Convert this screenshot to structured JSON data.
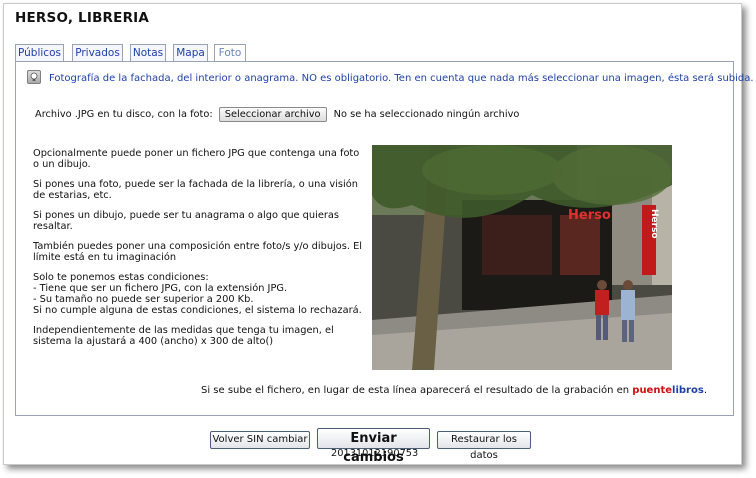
{
  "page": {
    "title": "HERSO, LIBRERIA"
  },
  "tabs": [
    {
      "label": "Públicos",
      "active": false
    },
    {
      "label": "Privados",
      "active": false
    },
    {
      "label": "Notas",
      "active": false
    },
    {
      "label": "Mapa",
      "active": false
    },
    {
      "label": "Foto",
      "active": true
    }
  ],
  "panel": {
    "info_text": "Fotografía de la fachada, del interior o anagrama. NO es obligatorio. Ten en cuenta que nada más seleccionar una imagen, ésta será subida.",
    "file": {
      "label": "Archivo .JPG en tu disco, con la foto:",
      "button_label": "Seleccionar archivo",
      "status": "No se ha seleccionado ningún archivo"
    },
    "description": [
      "Opcionalmente puede poner un fichero JPG que contenga una foto o un dibujo.",
      "Si pones una foto, puede ser la fachada de la librería, o una visión de estarias, etc.",
      "Si pones un dibujo, puede ser tu anagrama o algo que quieras resaltar.",
      "También puedes poner una composición entre foto/s y/o dibujos. El límite está en tu imaginación",
      "Solo te ponemos estas condiciones:\n- Tiene que ser un fichero JPG, con la extensión JPG.\n- Su tamaño no puede ser superior a 200 Kb.\nSi no cumple alguna de estas condiciones, el sistema lo rechazará.",
      "Independientemente de las medidas que tenga tu imagen, el sistema la ajustará a 400 (ancho) x 300 de alto()"
    ],
    "photo": {
      "sign_top": "Herso",
      "sign_vertical": "Herso"
    },
    "result_line": {
      "prefix": "Si se sube el fichero, en lugar de esta línea aparecerá el resultado de la grabación en",
      "brand_part1": "puente",
      "brand_part2": "libros",
      "suffix": "."
    }
  },
  "actions": {
    "cancel_label": "Volver SIN cambiar",
    "submit_label": "Enviar cambios",
    "reset_label": "Restaurar los datos"
  },
  "footer": {
    "timestamp": "20131012190753"
  },
  "colors": {
    "link_blue": "#1f3fa8",
    "brand_red": "#d10f0f",
    "tab_border": "#9aa3b5"
  }
}
